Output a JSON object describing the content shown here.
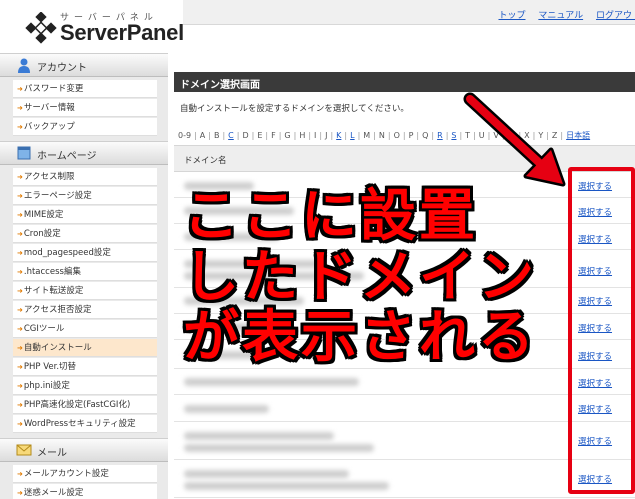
{
  "logo": {
    "kana": "サーバーパネル",
    "name": "ServerPanel"
  },
  "header": {
    "links": [
      "トップ",
      "マニュアル",
      "ログアウト"
    ]
  },
  "sidebar": {
    "sections": [
      {
        "label": "アカウント",
        "items": [
          "パスワード変更",
          "サーバー情報",
          "バックアップ"
        ]
      },
      {
        "label": "ホームページ",
        "items": [
          "アクセス制限",
          "エラーページ設定",
          "MIME設定",
          "Cron設定",
          "mod_pagespeed設定",
          ".htaccess編集",
          "サイト転送設定",
          "アクセス拒否設定",
          "CGIツール",
          "自動インストール",
          "PHP Ver.切替",
          "php.ini設定",
          "PHP高速化設定(FastCGI化)",
          "WordPressセキュリティ設定"
        ]
      },
      {
        "label": "メール",
        "items": [
          "メールアカウント設定",
          "迷惑メール設定"
        ]
      }
    ],
    "active_item": "自動インストール"
  },
  "main": {
    "title": "ドメイン選択画面",
    "instruction": "自動インストールを設定するドメインを選択してください。",
    "alpha_nav": [
      "0-9",
      "A",
      "B",
      "C",
      "D",
      "E",
      "F",
      "G",
      "H",
      "I",
      "J",
      "K",
      "L",
      "M",
      "N",
      "O",
      "P",
      "Q",
      "R",
      "S",
      "T",
      "U",
      "V",
      "W",
      "X",
      "Y",
      "Z",
      "日本語"
    ],
    "column_header": "ドメイン名",
    "select_label": "選択する",
    "row_count": 12
  },
  "overlay": {
    "lines": [
      "ここに設置",
      "したドメイン",
      "が表示される"
    ],
    "color": "#ff0000"
  }
}
